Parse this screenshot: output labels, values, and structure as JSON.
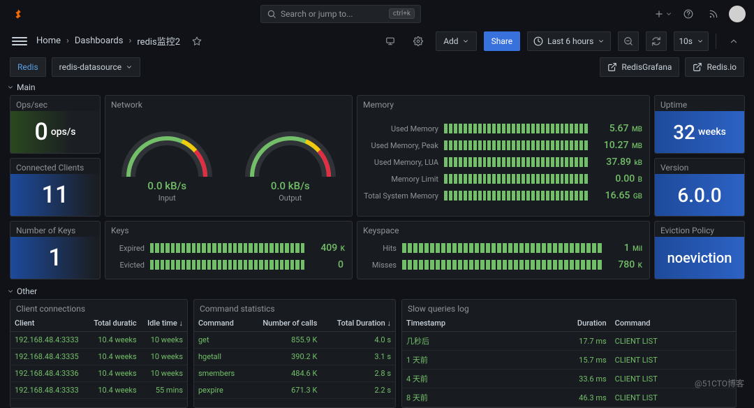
{
  "top": {
    "search_placeholder": "Search or jump to...",
    "shortcut": "ctrl+k"
  },
  "toolbar": {
    "breadcrumb": [
      "Home",
      "Dashboards",
      "redis监控2"
    ],
    "add_label": "Add",
    "share_label": "Share",
    "time_label": "Last 6 hours",
    "refresh_label": "10s"
  },
  "vars": {
    "label": "Redis",
    "value": "redis-datasource",
    "links": [
      "RedisGrafana",
      "Redis.io"
    ]
  },
  "sections": {
    "main": "Main",
    "other": "Other"
  },
  "panels": {
    "ops": {
      "title": "Ops/sec",
      "value": "0",
      "unit": "ops/s"
    },
    "clients": {
      "title": "Connected Clients",
      "value": "11"
    },
    "nkeys": {
      "title": "Number of Keys",
      "value": "1"
    },
    "network": {
      "title": "Network",
      "gauges": [
        {
          "value": "0.0 kB/s",
          "label": "Input"
        },
        {
          "value": "0.0 kB/s",
          "label": "Output"
        }
      ]
    },
    "keys": {
      "title": "Keys",
      "rows": [
        {
          "label": "Expired",
          "value": "409",
          "unit": "K"
        },
        {
          "label": "Evicted",
          "value": "0",
          "unit": ""
        }
      ]
    },
    "memory": {
      "title": "Memory",
      "rows": [
        {
          "label": "Used Memory",
          "value": "5.67",
          "unit": "MB"
        },
        {
          "label": "Used Memory, Peak",
          "value": "10.27",
          "unit": "MB"
        },
        {
          "label": "Used Memory, LUA",
          "value": "37.89",
          "unit": "kB"
        },
        {
          "label": "Memory Limit",
          "value": "0.00",
          "unit": "B"
        },
        {
          "label": "Total System Memory",
          "value": "16.65",
          "unit": "GB"
        }
      ]
    },
    "keyspace": {
      "title": "Keyspace",
      "rows": [
        {
          "label": "Hits",
          "value": "1",
          "unit": "Mil"
        },
        {
          "label": "Misses",
          "value": "780",
          "unit": "K"
        }
      ]
    },
    "uptime": {
      "title": "Uptime",
      "value": "32",
      "unit": "weeks"
    },
    "version": {
      "title": "Version",
      "value": "6.0.0"
    },
    "eviction": {
      "title": "Eviction Policy",
      "value": "noeviction"
    }
  },
  "tables": {
    "clients": {
      "title": "Client connections",
      "columns": [
        "Client",
        "Total duratic",
        "Idle time ↓"
      ],
      "rows": [
        [
          "192.168.48.4:3333",
          "10.4 weeks",
          "10 weeks"
        ],
        [
          "192.168.48.4:3335",
          "10.4 weeks",
          "10 weeks"
        ],
        [
          "192.168.48.4:3336",
          "10.4 weeks",
          "10 weeks"
        ],
        [
          "192.168.48.4:3333",
          "10.4 weeks",
          "55 mins"
        ]
      ]
    },
    "commands": {
      "title": "Command statistics",
      "columns": [
        "Command",
        "Number of calls",
        "Total Duration ↓"
      ],
      "rows": [
        [
          "get",
          "855.9 K",
          "4.0 s"
        ],
        [
          "hgetall",
          "390.2 K",
          "3.1 s"
        ],
        [
          "smembers",
          "484.6 K",
          "2.8 s"
        ],
        [
          "pexpire",
          "671.3 K",
          "2.2 s"
        ]
      ]
    },
    "slow": {
      "title": "Slow queries log",
      "columns": [
        "Timestamp",
        "Duration",
        "Command"
      ],
      "rows": [
        [
          "几秒后",
          "17.7 ms",
          "CLIENT LIST"
        ],
        [
          "1 天前",
          "15.7 ms",
          "CLIENT LIST"
        ],
        [
          "4 天前",
          "33.6 ms",
          "CLIENT LIST"
        ],
        [
          "8 天前",
          "46.3 ms",
          "CLIENT LIST"
        ]
      ]
    }
  },
  "watermark": "@51CTO博客"
}
